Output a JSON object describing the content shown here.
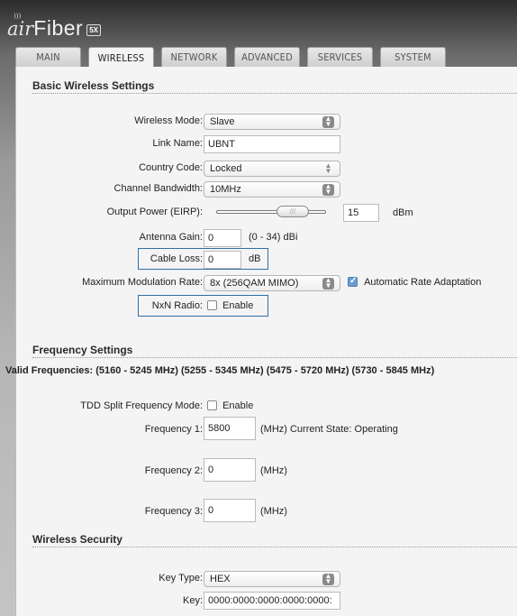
{
  "logo": {
    "air": "air",
    "fiber": "Fiber",
    "badge": "5X"
  },
  "tabs": [
    "MAIN",
    "WIRELESS",
    "NETWORK",
    "ADVANCED",
    "SERVICES",
    "SYSTEM"
  ],
  "basic": {
    "title": "Basic Wireless Settings",
    "wireless_mode": {
      "label": "Wireless Mode:",
      "value": "Slave"
    },
    "link_name": {
      "label": "Link Name:",
      "value": "UBNT"
    },
    "country_code": {
      "label": "Country Code:",
      "value": "Locked"
    },
    "channel_bandwidth": {
      "label": "Channel Bandwidth:",
      "value": "10MHz"
    },
    "output_power": {
      "label": "Output Power (EIRP):",
      "value": "15",
      "unit": "dBm",
      "knob": "///"
    },
    "antenna_gain": {
      "label": "Antenna Gain:",
      "value": "0",
      "range": "(0 - 34) dBi"
    },
    "cable_loss": {
      "label": "Cable Loss:",
      "value": "0",
      "unit": "dB"
    },
    "max_mod_rate": {
      "label": "Maximum Modulation Rate:",
      "value": "8x (256QAM MIMO)",
      "auto_label": "Automatic Rate Adaptation",
      "auto_checked": true
    },
    "nxn_radio": {
      "label": "NxN Radio:",
      "enable_label": "Enable",
      "checked": false
    }
  },
  "frequency": {
    "title": "Frequency Settings",
    "valid": "Valid Frequencies: (5160 - 5245 MHz) (5255 - 5345 MHz) (5475 - 5720 MHz) (5730 - 5845 MHz)",
    "tdd": {
      "label": "TDD Split Frequency Mode:",
      "enable_label": "Enable",
      "checked": false
    },
    "f1": {
      "label": "Frequency 1:",
      "value": "5800",
      "note": "(MHz) Current State: Operating"
    },
    "f2": {
      "label": "Frequency 2:",
      "value": "0",
      "note": "(MHz)"
    },
    "f3": {
      "label": "Frequency 3:",
      "value": "0",
      "note": "(MHz)"
    }
  },
  "security": {
    "title": "Wireless Security",
    "key_type": {
      "label": "Key Type:",
      "value": "HEX"
    },
    "key": {
      "label": "Key:",
      "value": "0000:0000:0000:0000:0000:"
    }
  }
}
